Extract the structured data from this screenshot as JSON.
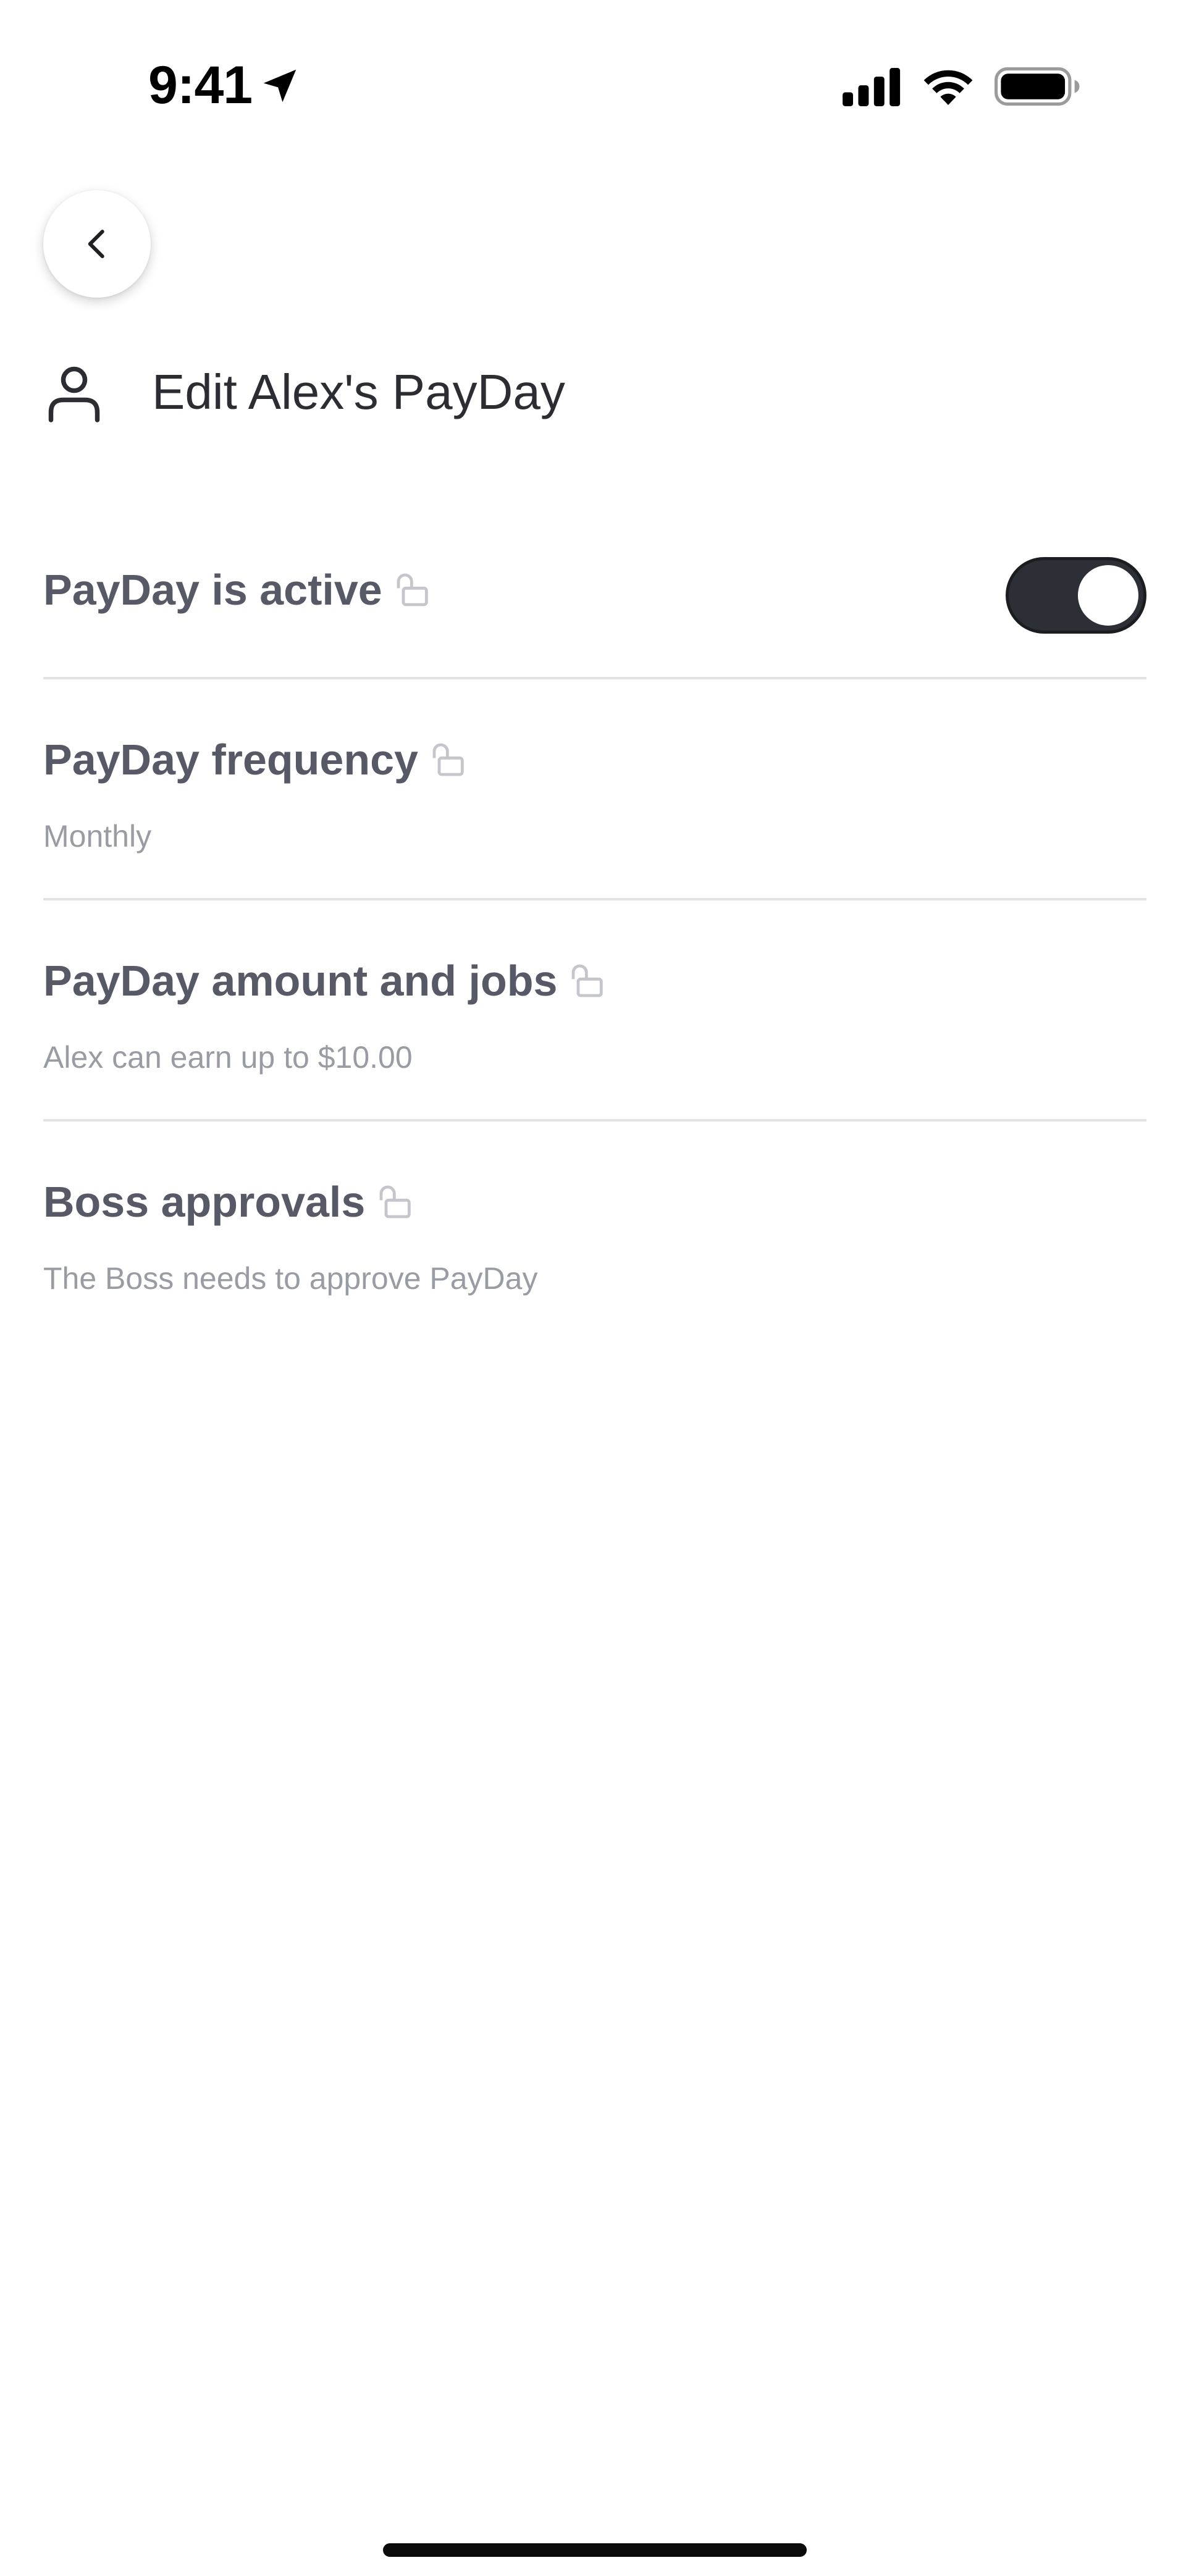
{
  "status_bar": {
    "time": "9:41",
    "icons": [
      "location-arrow-icon",
      "cellular-signal-icon",
      "wifi-icon",
      "battery-icon"
    ]
  },
  "header": {
    "back_icon": "chevron-left-icon",
    "user_icon": "person-icon",
    "title": "Edit Alex's PayDay"
  },
  "settings": {
    "active": {
      "title": "PayDay is active",
      "lock_icon": "unlocked-padlock-icon",
      "toggle_on": true
    },
    "frequency": {
      "title": "PayDay frequency",
      "lock_icon": "unlocked-padlock-icon",
      "value": "Monthly"
    },
    "amount": {
      "title": "PayDay amount and jobs",
      "lock_icon": "unlocked-padlock-icon",
      "value": "Alex can earn up to $10.00"
    },
    "approvals": {
      "title": "Boss approvals",
      "lock_icon": "unlocked-padlock-icon",
      "value": "The Boss needs to approve PayDay"
    }
  },
  "colors": {
    "toggle_track": "#2d2f36",
    "title_text": "#575a66",
    "subtitle_text": "#9a9ca4",
    "divider": "#e2e3e6"
  }
}
